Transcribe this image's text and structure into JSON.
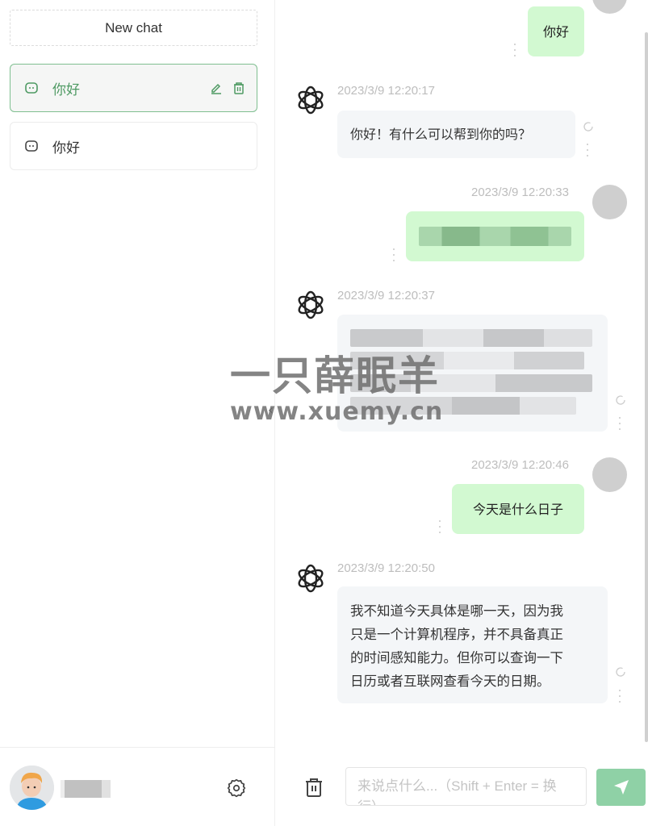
{
  "sidebar": {
    "new_chat_label": "New chat",
    "chats": [
      {
        "title": "你好",
        "active": true
      },
      {
        "title": "你好",
        "active": false
      }
    ],
    "user": {
      "name_redacted": true
    }
  },
  "messages": [
    {
      "role": "user",
      "text": "你好",
      "timestamp": ""
    },
    {
      "role": "assistant",
      "timestamp": "2023/3/9 12:20:17",
      "text": "你好！有什么可以帮到你的吗？"
    },
    {
      "role": "user",
      "timestamp": "2023/3/9 12:20:33",
      "text": "",
      "redacted": true
    },
    {
      "role": "assistant",
      "timestamp": "2023/3/9 12:20:37",
      "text": "",
      "redacted": true
    },
    {
      "role": "user",
      "timestamp": "2023/3/9 12:20:46",
      "text": "今天是什么日子"
    },
    {
      "role": "assistant",
      "timestamp": "2023/3/9 12:20:50",
      "lines": [
        "我不知道今天具体是哪一天，因为我",
        "只是一个计算机程序，并不具备真正",
        "的时间感知能力。但你可以查询一下",
        "日历或者互联网查看今天的日期。"
      ]
    }
  ],
  "input": {
    "placeholder": "来说点什么...（Shift + Enter = 换行）",
    "value": ""
  },
  "watermark": {
    "line1": "一只薛眠羊",
    "line2": "www.xuemy.cn"
  },
  "icons": {
    "chat": "chat-bubble-icon",
    "edit": "pencil-icon",
    "delete": "trash-icon",
    "settings": "gear-icon",
    "send": "send-icon",
    "bot": "openai-logo-icon",
    "collapse": "chevron-left-icon"
  },
  "colors": {
    "accent": "#4e9a63",
    "user_bubble": "#d2f9d1",
    "bot_bubble": "#f4f6f8",
    "send_button": "#8fd1a6"
  }
}
